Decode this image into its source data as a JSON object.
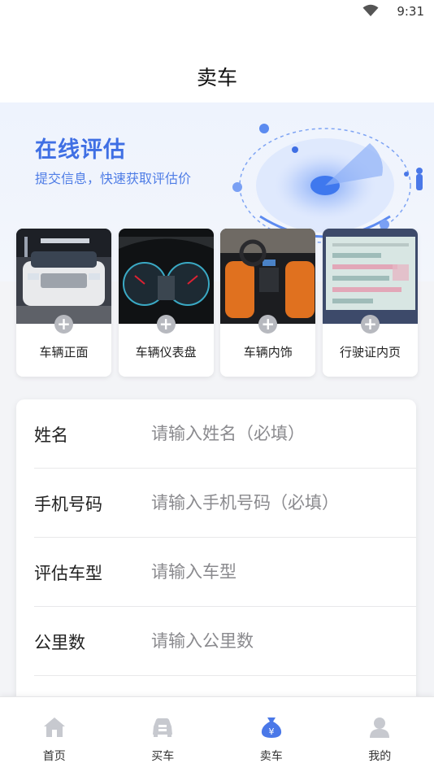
{
  "status_bar": {
    "time": "9:31"
  },
  "header": {
    "title": "卖车"
  },
  "banner": {
    "title": "在线评估",
    "subtitle": "提交信息，快速获取评估价"
  },
  "photos": [
    {
      "label": "车辆正面",
      "icon": "plus-icon"
    },
    {
      "label": "车辆仪表盘",
      "icon": "plus-icon"
    },
    {
      "label": "车辆内饰",
      "icon": "plus-icon"
    },
    {
      "label": "行驶证内页",
      "icon": "plus-icon"
    }
  ],
  "form": {
    "fields": [
      {
        "label": "姓名",
        "placeholder": "请输入姓名（必填）",
        "value": ""
      },
      {
        "label": "手机号码",
        "placeholder": "请输入手机号码（必填）",
        "value": ""
      },
      {
        "label": "评估车型",
        "placeholder": "请输入车型",
        "value": ""
      },
      {
        "label": "公里数",
        "placeholder": "请输入公里数",
        "value": ""
      }
    ]
  },
  "tabbar": {
    "items": [
      {
        "label": "首页",
        "icon": "home-icon",
        "active": false
      },
      {
        "label": "买车",
        "icon": "car-icon",
        "active": false
      },
      {
        "label": "卖车",
        "icon": "money-bag-icon",
        "active": true
      },
      {
        "label": "我的",
        "icon": "user-icon",
        "active": false
      }
    ]
  },
  "colors": {
    "accent": "#3f6fe4",
    "tab_active": "#4a78e8",
    "tab_inactive": "#c7c9cf",
    "plus_button": "#b7b9bf"
  }
}
